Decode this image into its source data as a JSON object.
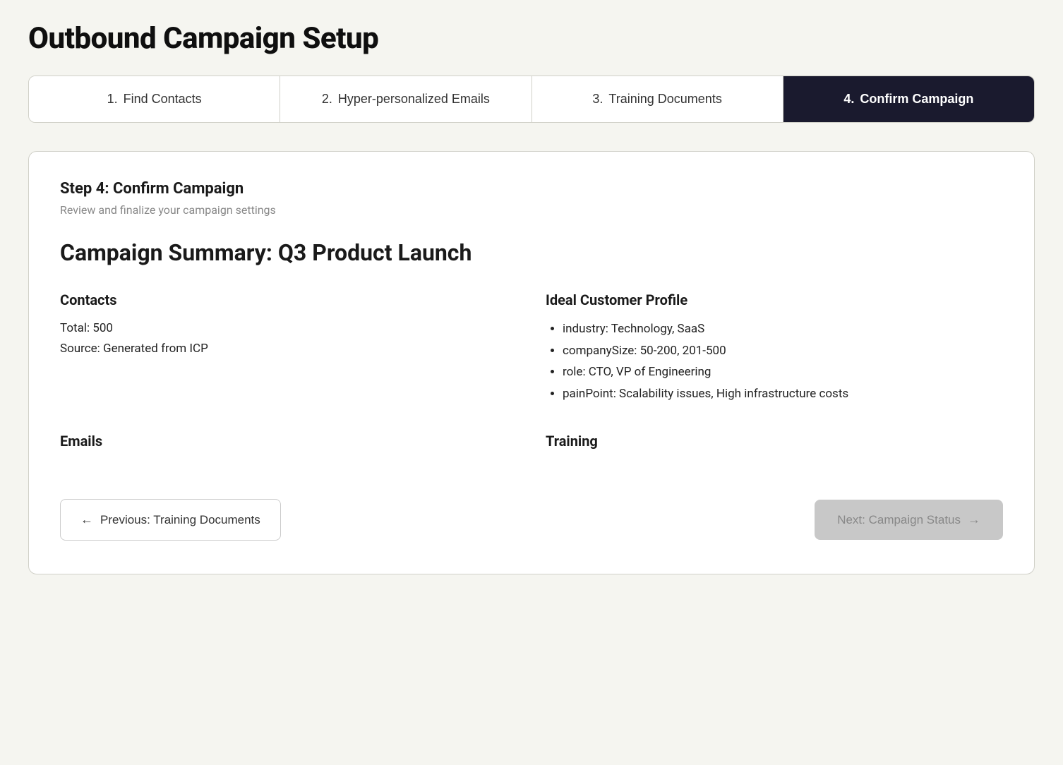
{
  "page": {
    "title": "Outbound Campaign Setup"
  },
  "steps": [
    {
      "id": "step-1",
      "number": "1.",
      "label": "Find Contacts",
      "active": false
    },
    {
      "id": "step-2",
      "number": "2.",
      "label": "Hyper-personalized Emails",
      "active": false
    },
    {
      "id": "step-3",
      "number": "3.",
      "label": "Training Documents",
      "active": false
    },
    {
      "id": "step-4",
      "number": "4.",
      "label": "Confirm Campaign",
      "active": true
    }
  ],
  "content": {
    "step_header_title": "Step 4: Confirm Campaign",
    "step_header_subtitle": "Review and finalize your campaign settings",
    "campaign_summary_title": "Campaign Summary: Q3 Product Launch",
    "contacts_section": {
      "title": "Contacts",
      "total": "Total: 500",
      "source": "Source: Generated from ICP"
    },
    "icp_section": {
      "title": "Ideal Customer Profile",
      "items": [
        "industry: Technology, SaaS",
        "companySize: 50-200, 201-500",
        "role: CTO, VP of Engineering",
        "painPoint: Scalability issues, High infrastructure costs"
      ]
    },
    "emails_section": {
      "title": "Emails"
    },
    "training_section": {
      "title": "Training"
    }
  },
  "buttons": {
    "prev_label": "Previous: Training Documents",
    "next_label": "Next: Campaign Status",
    "prev_arrow": "←",
    "next_arrow": "→"
  }
}
